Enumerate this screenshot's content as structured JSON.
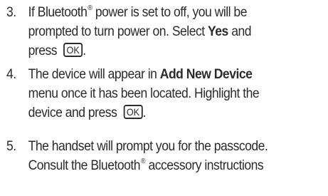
{
  "steps": [
    {
      "number": "3.",
      "lines": [
        [
          "If Bluetooth",
          "®",
          " power is set to off, you will be"
        ],
        [
          "prompted to turn power on. Select ",
          "Yes",
          " and"
        ],
        [
          "press",
          "OK",
          "."
        ]
      ]
    },
    {
      "number": "4.",
      "lines": [
        [
          "The device will appear in ",
          "Add New Device"
        ],
        [
          "menu once it has been located. Highlight the"
        ],
        [
          "device and press",
          "OK",
          "."
        ]
      ]
    },
    {
      "number": "5.",
      "lines": [
        [
          "The handset will prompt you for the passcode."
        ],
        [
          "Consult the Bluetooth",
          "®",
          " accessory instructions"
        ]
      ]
    }
  ]
}
